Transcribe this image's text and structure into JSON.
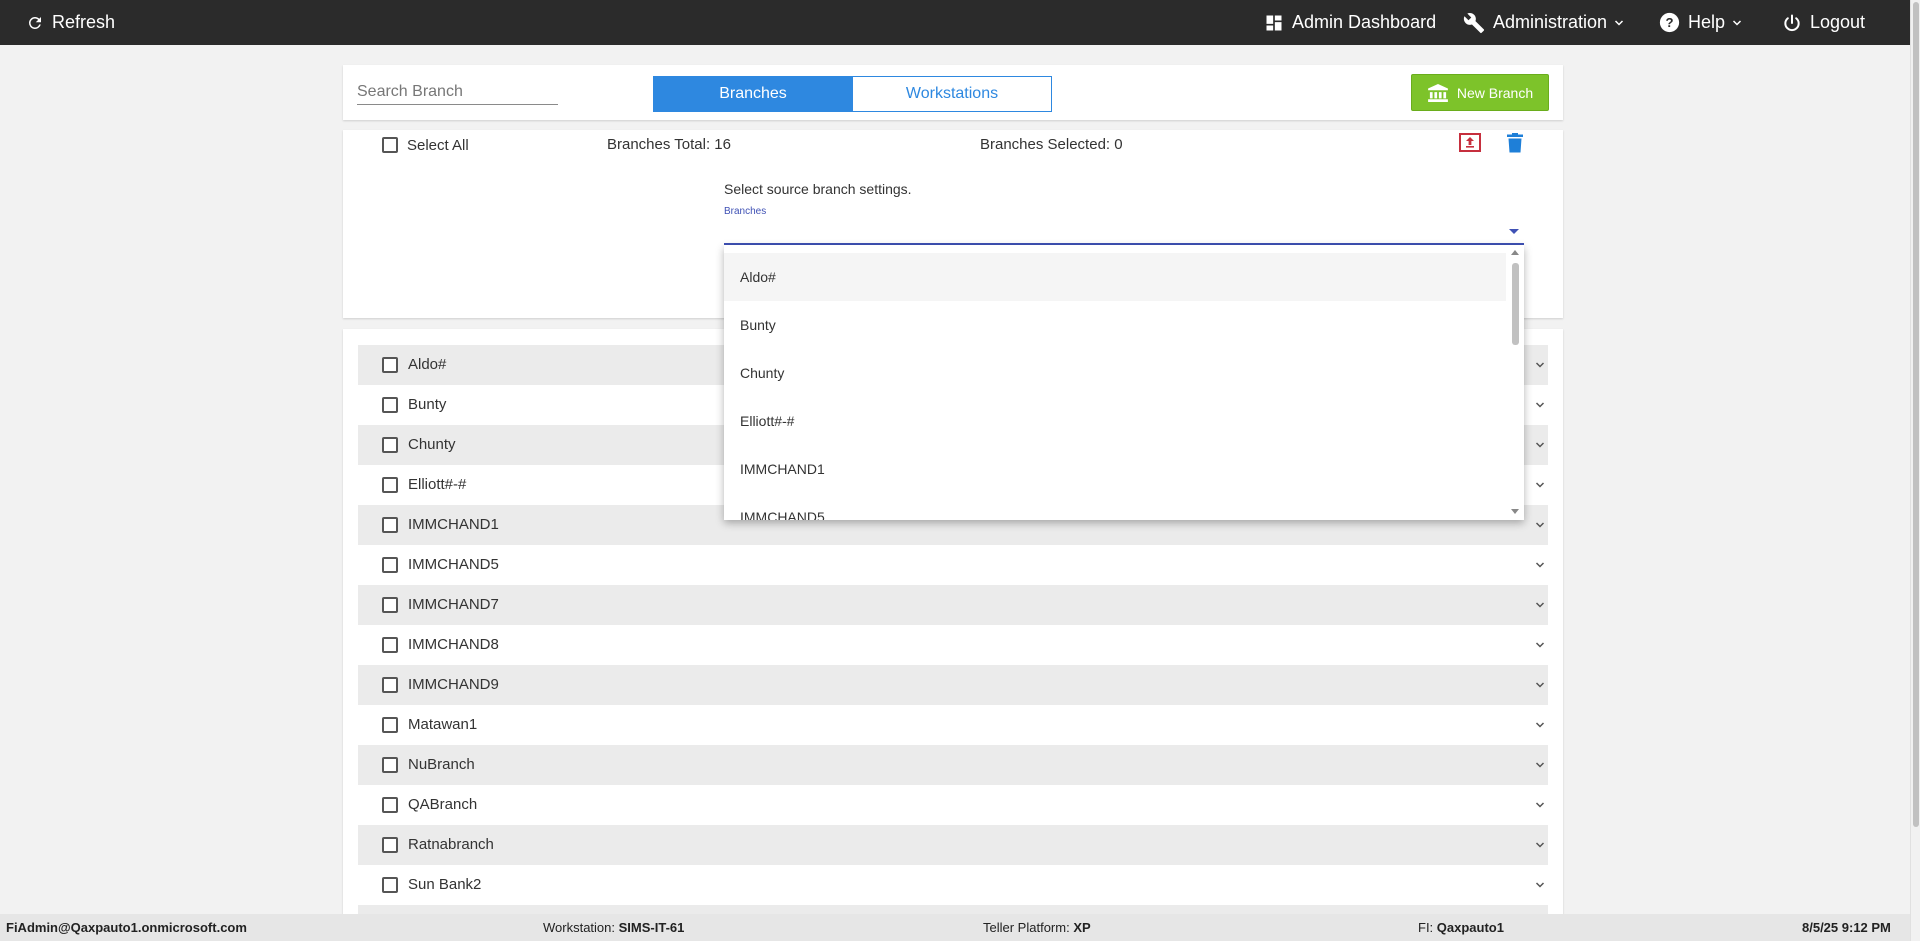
{
  "topbar": {
    "refresh_label": "Refresh",
    "admin_dashboard_label": "Admin Dashboard",
    "administration_label": "Administration",
    "help_label": "Help",
    "logout_label": "Logout"
  },
  "header": {
    "search_placeholder": "Search Branch",
    "search_value": "",
    "tabs": [
      {
        "label": "Branches",
        "active": true
      },
      {
        "label": "Workstations",
        "active": false
      }
    ],
    "new_branch_label": "New Branch"
  },
  "toolbar": {
    "select_all_label": "Select All",
    "branches_total_text": "Branches Total: 16",
    "branches_selected_text": "Branches Selected: 0",
    "source_prompt": "Select source branch settings.",
    "branches_field_label": "Branches"
  },
  "dropdown": {
    "options": [
      "Aldo#",
      "Bunty",
      "Chunty",
      "Elliott#-#",
      "IMMCHAND1",
      "IMMCHAND5"
    ]
  },
  "branches": [
    "Aldo#",
    "Bunty",
    "Chunty",
    "Elliott#-#",
    "IMMCHAND1",
    "IMMCHAND5",
    "IMMCHAND7",
    "IMMCHAND8",
    "IMMCHAND9",
    "Matawan1",
    "NuBranch",
    "QABranch",
    "Ratnabranch",
    "Sun Bank2"
  ],
  "statusbar": {
    "user": "FiAdmin@Qaxpauto1.onmicrosoft.com",
    "workstation_label": "Workstation:",
    "workstation_value": "SIMS-IT-61",
    "platform_label": "Teller Platform:",
    "platform_value": "XP",
    "fi_label": "FI:",
    "fi_value": "Qaxpauto1",
    "datetime": "8/5/25 9:12 PM"
  },
  "colors": {
    "topbar_bg": "#2b2b2b",
    "tab_blue": "#2e88e0",
    "new_branch_green": "#7dc32a",
    "select_indigo": "#3f51b5",
    "export_red": "#c62f3e",
    "delete_blue": "#1e7fd8"
  },
  "icons": {
    "refresh": "refresh-icon",
    "dashboard": "dashboard-icon",
    "administration": "wrench-icon",
    "help": "help-circle-icon",
    "logout": "power-icon",
    "new_branch": "bank-icon",
    "export": "export-icon",
    "delete": "trash-icon",
    "row_expand": "chevron-down-icon"
  }
}
